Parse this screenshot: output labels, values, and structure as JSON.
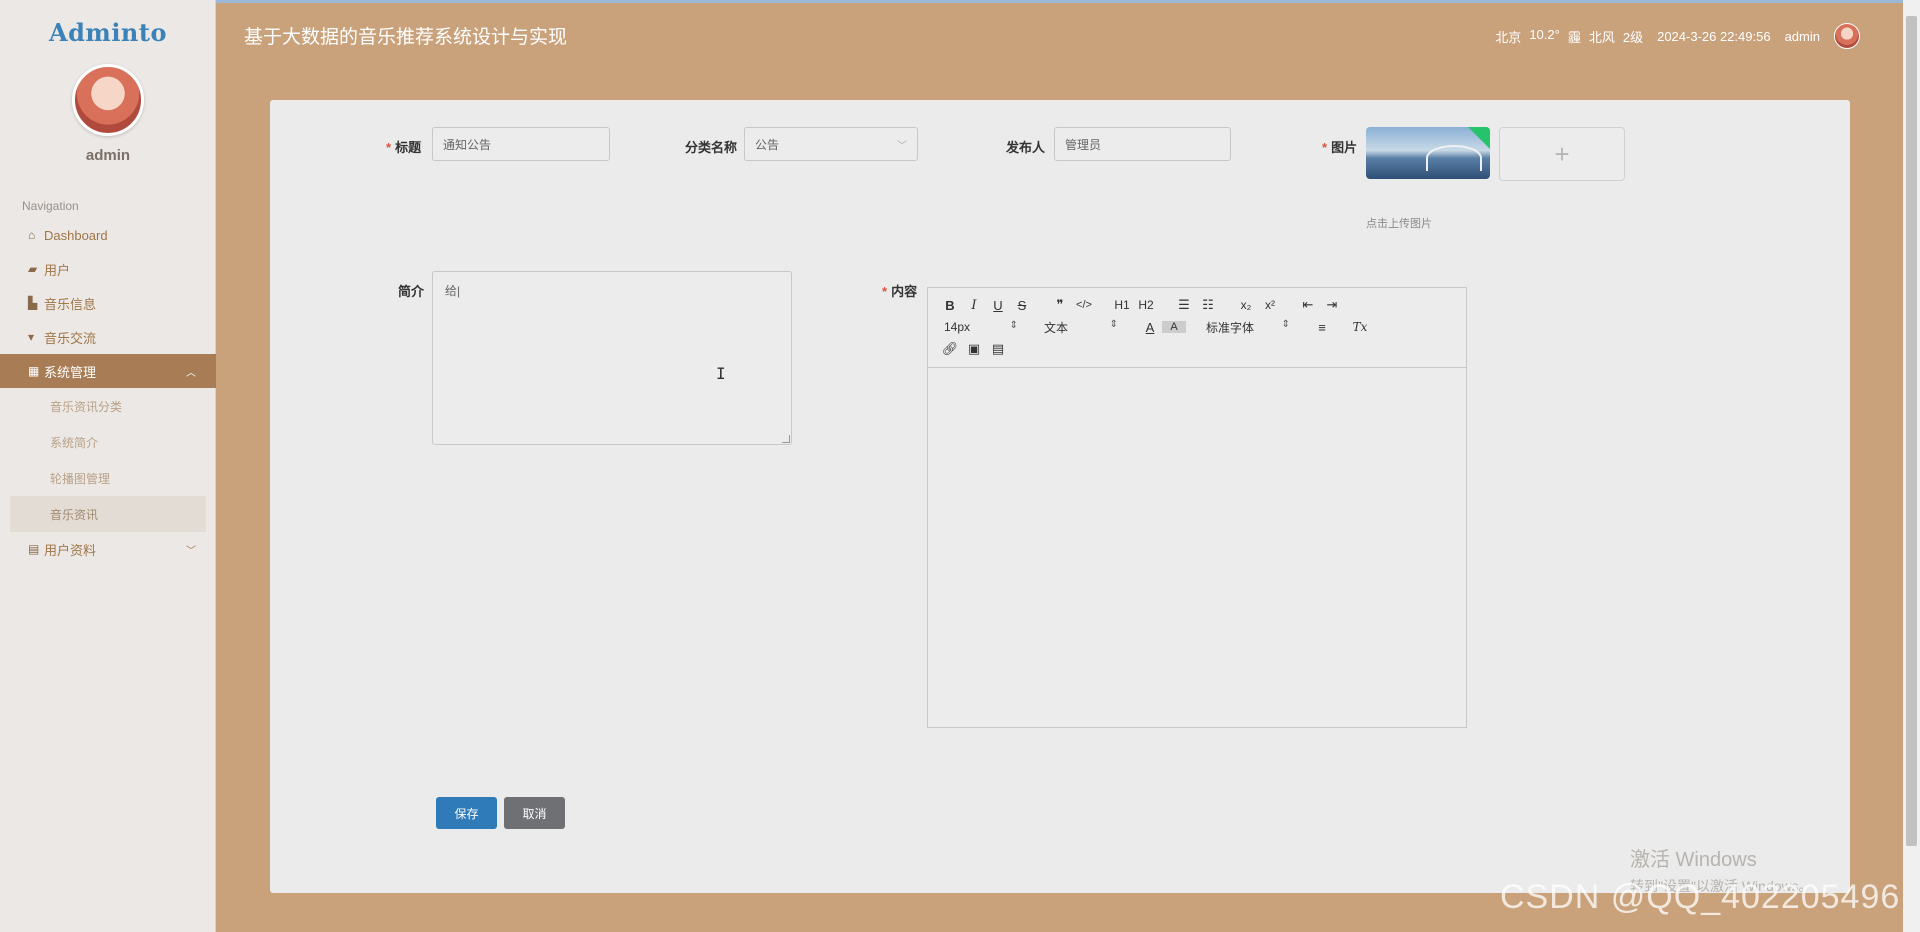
{
  "brand": "Adminto",
  "sidebar": {
    "username": "admin",
    "nav_title": "Navigation",
    "items": [
      {
        "label": "Dashboard",
        "icon": "home-icon"
      },
      {
        "label": "用户",
        "icon": "user-icon"
      },
      {
        "label": "音乐信息",
        "icon": "music-icon"
      },
      {
        "label": "音乐交流",
        "icon": "chat-icon"
      },
      {
        "label": "系统管理",
        "icon": "grid-icon"
      },
      {
        "label": "用户资料",
        "icon": "file-icon"
      }
    ],
    "sub_items": [
      {
        "label": "音乐资讯分类"
      },
      {
        "label": "系统简介"
      },
      {
        "label": "轮播图管理"
      },
      {
        "label": "音乐资讯"
      }
    ]
  },
  "header": {
    "title": "基于大数据的音乐推荐系统设计与实现",
    "city": "北京",
    "temp": "10.2°",
    "weather": "霾",
    "wind": "北风",
    "level": "2级",
    "datetime": "2024-3-26 22:49:56",
    "user": "admin"
  },
  "form": {
    "title_label": "标题",
    "title_value": "通知公告",
    "category_label": "分类名称",
    "category_value": "公告",
    "publisher_label": "发布人",
    "publisher_value": "管理员",
    "image_label": "图片",
    "upload_add": "+",
    "upload_hint": "点击上传图片",
    "intro_label": "简介",
    "intro_value": "给|",
    "content_label": "内容",
    "save": "保存",
    "cancel": "取消"
  },
  "editor": {
    "font_size": "14px",
    "paragraph": "文本",
    "font_family": "标准字体",
    "bold": "B",
    "italic": "I",
    "underline": "U",
    "strike": "S",
    "quote": "❞",
    "code": "</>",
    "h1": "H1",
    "h2": "H2",
    "sub": "x₂",
    "sup": "x²",
    "clean": "Tx",
    "text_color": "A",
    "bg_color": "A"
  },
  "watermark": {
    "line1": "激活 Windows",
    "line2": "转到\"设置\"以激活 Windows。",
    "csdn": "CSDN @QQ_402205496"
  },
  "colors": {
    "background": "#c9a27c",
    "sidebar": "#ebe8e6",
    "active_nav": "#a87c55",
    "save_button": "#2f7ab8",
    "cancel_button": "#6e7074",
    "required": "#e0503c"
  }
}
